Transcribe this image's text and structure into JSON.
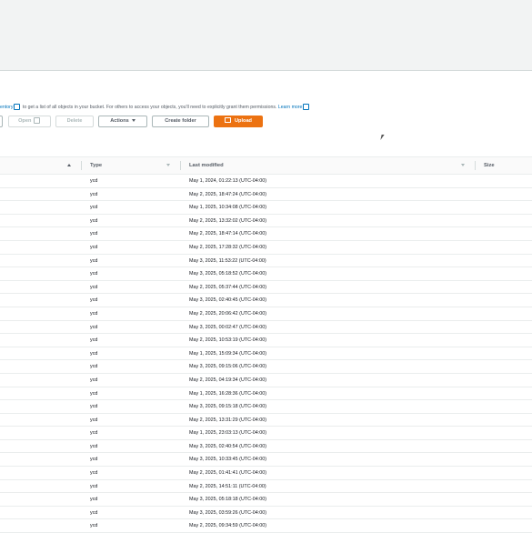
{
  "info": {
    "link_start": "entory",
    "text": "to get a list of all objects in your bucket. For others to access your objects, you'll need to explicitly grant them permissions.",
    "learn_more": "Learn more"
  },
  "toolbar": {
    "open_label": "Open",
    "delete_label": "Delete",
    "actions_label": "Actions",
    "create_folder_label": "Create folder",
    "upload_label": "Upload"
  },
  "table": {
    "columns": {
      "type": "Type",
      "last_modified": "Last modified",
      "size": "Size"
    },
    "rows": [
      {
        "type": "ycd",
        "modified": "May 1, 2024, 01:22:13 (UTC-04:00)"
      },
      {
        "type": "ycd",
        "modified": "May 2, 2025, 18:47:24 (UTC-04:00)"
      },
      {
        "type": "ycd",
        "modified": "May 1, 2025, 10:34:08 (UTC-04:00)"
      },
      {
        "type": "ycd",
        "modified": "May 2, 2025, 13:32:02 (UTC-04:00)"
      },
      {
        "type": "ycd",
        "modified": "May 2, 2025, 18:47:14 (UTC-04:00)"
      },
      {
        "type": "ycd",
        "modified": "May 2, 2025, 17:28:32 (UTC-04:00)"
      },
      {
        "type": "ycd",
        "modified": "May 3, 2025, 11:53:22 (UTC-04:00)"
      },
      {
        "type": "ycd",
        "modified": "May 3, 2025, 05:18:52 (UTC-04:00)"
      },
      {
        "type": "ycd",
        "modified": "May 2, 2025, 05:37:44 (UTC-04:00)"
      },
      {
        "type": "ycd",
        "modified": "May 3, 2025, 02:40:45 (UTC-04:00)"
      },
      {
        "type": "ycd",
        "modified": "May 2, 2025, 20:06:42 (UTC-04:00)"
      },
      {
        "type": "ycd",
        "modified": "May 3, 2025, 00:02:47 (UTC-04:00)"
      },
      {
        "type": "ycd",
        "modified": "May 2, 2025, 10:53:19 (UTC-04:00)"
      },
      {
        "type": "ycd",
        "modified": "May 1, 2025, 15:09:34 (UTC-04:00)"
      },
      {
        "type": "ycd",
        "modified": "May 3, 2025, 09:15:06 (UTC-04:00)"
      },
      {
        "type": "ycd",
        "modified": "May 2, 2025, 04:19:34 (UTC-04:00)"
      },
      {
        "type": "ycd",
        "modified": "May 1, 2025, 16:28:36 (UTC-04:00)"
      },
      {
        "type": "ycd",
        "modified": "May 3, 2025, 09:15:18 (UTC-04:00)"
      },
      {
        "type": "ycd",
        "modified": "May 2, 2025, 13:31:29 (UTC-04:00)"
      },
      {
        "type": "ycd",
        "modified": "May 1, 2025, 23:03:13 (UTC-04:00)"
      },
      {
        "type": "ycd",
        "modified": "May 3, 2025, 02:40:54 (UTC-04:00)"
      },
      {
        "type": "ycd",
        "modified": "May 3, 2025, 10:33:45 (UTC-04:00)"
      },
      {
        "type": "ycd",
        "modified": "May 2, 2025, 01:41:41 (UTC-04:00)"
      },
      {
        "type": "ycd",
        "modified": "May 2, 2025, 14:51:11 (UTC-04:00)"
      },
      {
        "type": "ycd",
        "modified": "May 3, 2025, 05:18:18 (UTC-04:00)"
      },
      {
        "type": "ycd",
        "modified": "May 3, 2025, 03:59:26 (UTC-04:00)"
      },
      {
        "type": "ycd",
        "modified": "May 2, 2025, 09:34:59 (UTC-04:00)"
      }
    ]
  },
  "icons": {
    "external_link": "external-link-icon",
    "dropdown": "caret-down-icon",
    "upload": "upload-icon",
    "sort_asc": "sort-ascending-icon",
    "sort": "sort-descending-icon",
    "cursor": "mouse-pointer-icon"
  },
  "colors": {
    "accent": "#ec7211",
    "link": "#0073bb",
    "header_band": "#f2f3f3"
  }
}
